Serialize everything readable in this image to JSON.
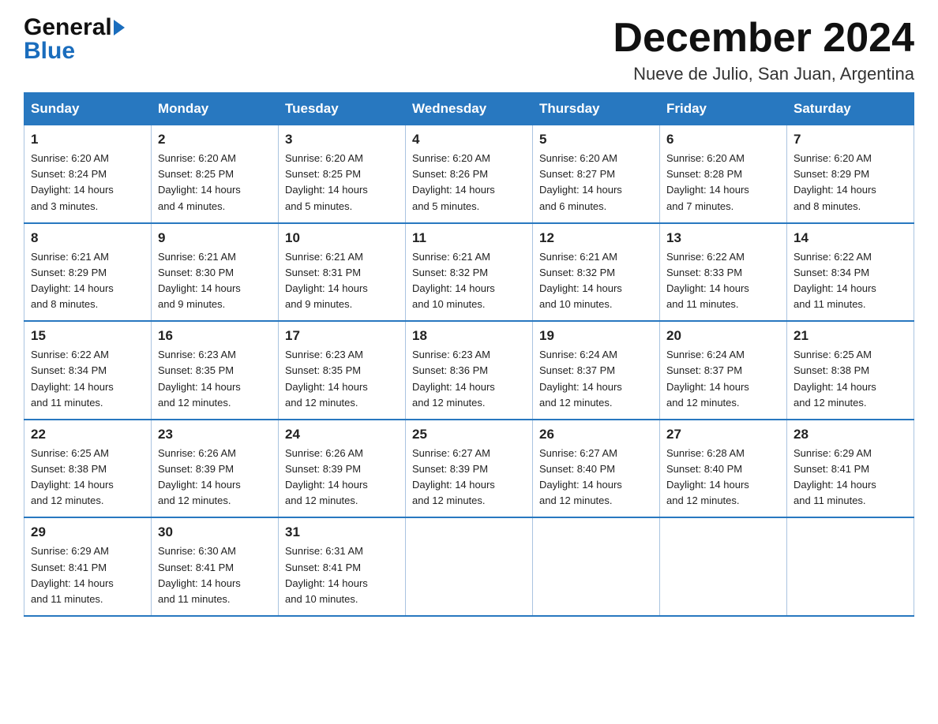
{
  "logo": {
    "line1": "General",
    "line2": "Blue"
  },
  "header": {
    "month_title": "December 2024",
    "subtitle": "Nueve de Julio, San Juan, Argentina"
  },
  "days_of_week": [
    "Sunday",
    "Monday",
    "Tuesday",
    "Wednesday",
    "Thursday",
    "Friday",
    "Saturday"
  ],
  "weeks": [
    [
      {
        "day": "1",
        "sunrise": "6:20 AM",
        "sunset": "8:24 PM",
        "daylight": "14 hours and 3 minutes."
      },
      {
        "day": "2",
        "sunrise": "6:20 AM",
        "sunset": "8:25 PM",
        "daylight": "14 hours and 4 minutes."
      },
      {
        "day": "3",
        "sunrise": "6:20 AM",
        "sunset": "8:25 PM",
        "daylight": "14 hours and 5 minutes."
      },
      {
        "day": "4",
        "sunrise": "6:20 AM",
        "sunset": "8:26 PM",
        "daylight": "14 hours and 5 minutes."
      },
      {
        "day": "5",
        "sunrise": "6:20 AM",
        "sunset": "8:27 PM",
        "daylight": "14 hours and 6 minutes."
      },
      {
        "day": "6",
        "sunrise": "6:20 AM",
        "sunset": "8:28 PM",
        "daylight": "14 hours and 7 minutes."
      },
      {
        "day": "7",
        "sunrise": "6:20 AM",
        "sunset": "8:29 PM",
        "daylight": "14 hours and 8 minutes."
      }
    ],
    [
      {
        "day": "8",
        "sunrise": "6:21 AM",
        "sunset": "8:29 PM",
        "daylight": "14 hours and 8 minutes."
      },
      {
        "day": "9",
        "sunrise": "6:21 AM",
        "sunset": "8:30 PM",
        "daylight": "14 hours and 9 minutes."
      },
      {
        "day": "10",
        "sunrise": "6:21 AM",
        "sunset": "8:31 PM",
        "daylight": "14 hours and 9 minutes."
      },
      {
        "day": "11",
        "sunrise": "6:21 AM",
        "sunset": "8:32 PM",
        "daylight": "14 hours and 10 minutes."
      },
      {
        "day": "12",
        "sunrise": "6:21 AM",
        "sunset": "8:32 PM",
        "daylight": "14 hours and 10 minutes."
      },
      {
        "day": "13",
        "sunrise": "6:22 AM",
        "sunset": "8:33 PM",
        "daylight": "14 hours and 11 minutes."
      },
      {
        "day": "14",
        "sunrise": "6:22 AM",
        "sunset": "8:34 PM",
        "daylight": "14 hours and 11 minutes."
      }
    ],
    [
      {
        "day": "15",
        "sunrise": "6:22 AM",
        "sunset": "8:34 PM",
        "daylight": "14 hours and 11 minutes."
      },
      {
        "day": "16",
        "sunrise": "6:23 AM",
        "sunset": "8:35 PM",
        "daylight": "14 hours and 12 minutes."
      },
      {
        "day": "17",
        "sunrise": "6:23 AM",
        "sunset": "8:35 PM",
        "daylight": "14 hours and 12 minutes."
      },
      {
        "day": "18",
        "sunrise": "6:23 AM",
        "sunset": "8:36 PM",
        "daylight": "14 hours and 12 minutes."
      },
      {
        "day": "19",
        "sunrise": "6:24 AM",
        "sunset": "8:37 PM",
        "daylight": "14 hours and 12 minutes."
      },
      {
        "day": "20",
        "sunrise": "6:24 AM",
        "sunset": "8:37 PM",
        "daylight": "14 hours and 12 minutes."
      },
      {
        "day": "21",
        "sunrise": "6:25 AM",
        "sunset": "8:38 PM",
        "daylight": "14 hours and 12 minutes."
      }
    ],
    [
      {
        "day": "22",
        "sunrise": "6:25 AM",
        "sunset": "8:38 PM",
        "daylight": "14 hours and 12 minutes."
      },
      {
        "day": "23",
        "sunrise": "6:26 AM",
        "sunset": "8:39 PM",
        "daylight": "14 hours and 12 minutes."
      },
      {
        "day": "24",
        "sunrise": "6:26 AM",
        "sunset": "8:39 PM",
        "daylight": "14 hours and 12 minutes."
      },
      {
        "day": "25",
        "sunrise": "6:27 AM",
        "sunset": "8:39 PM",
        "daylight": "14 hours and 12 minutes."
      },
      {
        "day": "26",
        "sunrise": "6:27 AM",
        "sunset": "8:40 PM",
        "daylight": "14 hours and 12 minutes."
      },
      {
        "day": "27",
        "sunrise": "6:28 AM",
        "sunset": "8:40 PM",
        "daylight": "14 hours and 12 minutes."
      },
      {
        "day": "28",
        "sunrise": "6:29 AM",
        "sunset": "8:41 PM",
        "daylight": "14 hours and 11 minutes."
      }
    ],
    [
      {
        "day": "29",
        "sunrise": "6:29 AM",
        "sunset": "8:41 PM",
        "daylight": "14 hours and 11 minutes."
      },
      {
        "day": "30",
        "sunrise": "6:30 AM",
        "sunset": "8:41 PM",
        "daylight": "14 hours and 11 minutes."
      },
      {
        "day": "31",
        "sunrise": "6:31 AM",
        "sunset": "8:41 PM",
        "daylight": "14 hours and 10 minutes."
      },
      null,
      null,
      null,
      null
    ]
  ],
  "labels": {
    "sunrise": "Sunrise:",
    "sunset": "Sunset:",
    "daylight": "Daylight:"
  }
}
